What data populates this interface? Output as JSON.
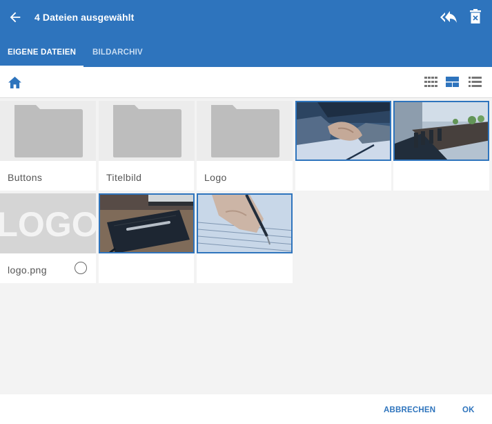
{
  "header": {
    "title": "4 Dateien ausgewählt",
    "back_icon": "arrow-left-icon",
    "reply_all_icon": "reply-all-icon",
    "delete_icon": "trash-icon"
  },
  "tabs": [
    {
      "label": "EIGENE DATEIEN",
      "active": true
    },
    {
      "label": "BILDARCHIV",
      "active": false
    }
  ],
  "toolbar": {
    "home_icon": "home-icon",
    "views": [
      "grid-view-icon",
      "card-view-icon",
      "list-view-icon"
    ],
    "active_view": "card-view-icon"
  },
  "files": [
    {
      "type": "folder",
      "label": "Buttons",
      "selected": false
    },
    {
      "type": "folder",
      "label": "Titelbild",
      "selected": false
    },
    {
      "type": "folder",
      "label": "Logo",
      "selected": false
    },
    {
      "type": "image",
      "label": "",
      "subject": "handshake",
      "selected": true
    },
    {
      "type": "image",
      "label": "",
      "subject": "conference-room",
      "selected": true
    },
    {
      "type": "image",
      "label": "logo.png",
      "subject": "logo",
      "thumb_text": "LOGO",
      "selected": false
    },
    {
      "type": "image",
      "label": "",
      "subject": "notebook-pen",
      "selected": true
    },
    {
      "type": "image",
      "label": "",
      "subject": "writing-hand",
      "selected": true
    }
  ],
  "footer": {
    "cancel_label": "ABBRECHEN",
    "ok_label": "OK"
  },
  "colors": {
    "primary": "#2e74bd",
    "background": "#f3f3f3",
    "folder": "#bdbdbd"
  }
}
